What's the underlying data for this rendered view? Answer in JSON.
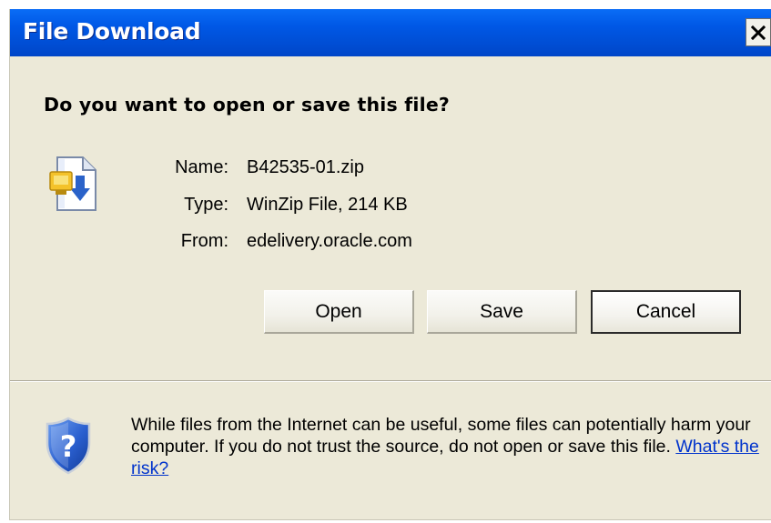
{
  "window": {
    "title": "File Download",
    "close_glyph": "×"
  },
  "prompt": {
    "question": "Do you want to open or save this file?"
  },
  "file": {
    "icon": "winzip-file-icon",
    "name_label": "Name:",
    "name_value": "B42535-01.zip",
    "type_label": "Type:",
    "type_value": "WinZip File, 214 KB",
    "from_label": "From:",
    "from_value": "edelivery.oracle.com"
  },
  "buttons": {
    "open": "Open",
    "save": "Save",
    "cancel": "Cancel"
  },
  "warning": {
    "icon": "security-shield-icon",
    "text": "While files from the Internet can be useful, some files can potentially harm your computer. If you do not trust the source, do not open or save this file.",
    "link": "What's the risk?"
  },
  "colors": {
    "titlebar": "#0058e6",
    "dialog_bg": "#ece9d8",
    "link": "#0033cc"
  }
}
